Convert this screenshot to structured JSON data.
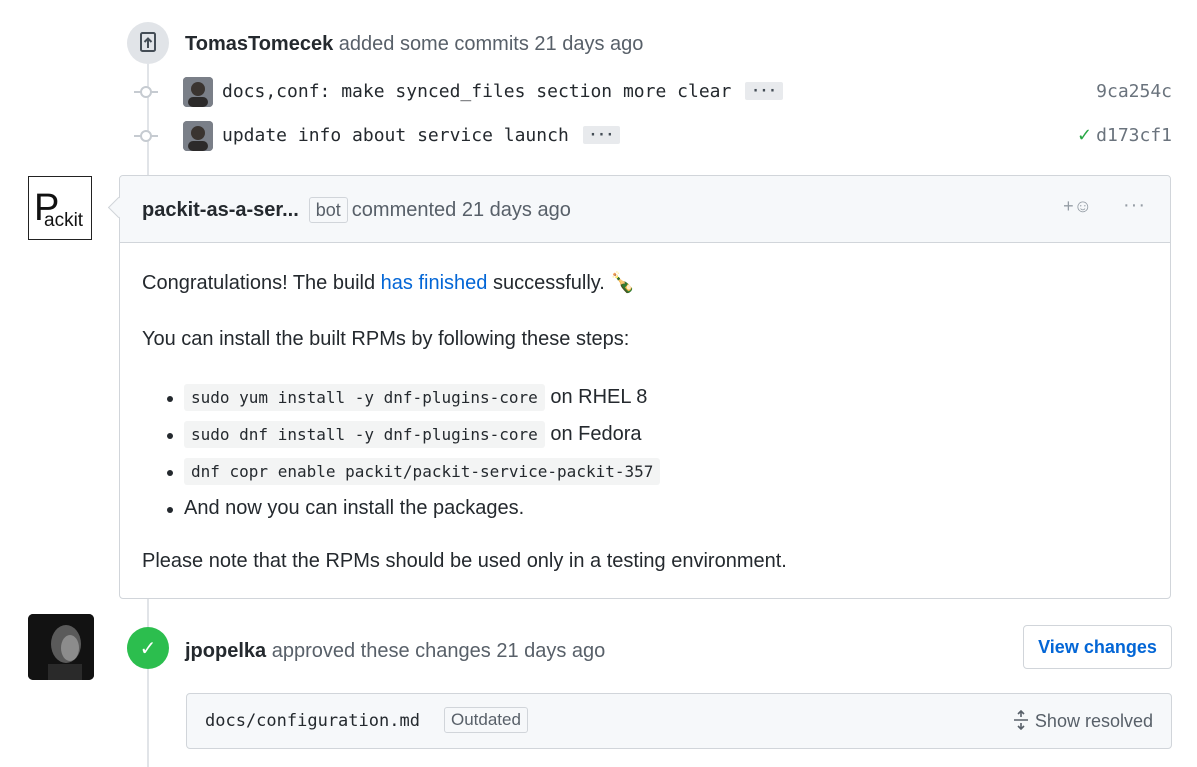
{
  "commits_event": {
    "author": "TomasTomecek",
    "action": "added some commits",
    "time": "21 days ago"
  },
  "commits": [
    {
      "message": "docs,conf: make synced_files section more clear",
      "sha": "9ca254c",
      "verified_check": false
    },
    {
      "message": "update info about service launch",
      "sha": "d173cf1",
      "verified_check": true
    }
  ],
  "comment": {
    "author": "packit-as-a-ser...",
    "badge": "bot",
    "action": "commented",
    "time": "21 days ago",
    "avatar_text": "ackit",
    "avatar_letter": "P",
    "reaction_label": "+☺",
    "more_label": "···",
    "congrats_before": "Congratulations! The build ",
    "congrats_link": "has finished",
    "congrats_after": " successfully. 🍾",
    "intro": "You can install the built RPMs by following these steps:",
    "steps": [
      {
        "code": "sudo yum install -y dnf-plugins-core",
        "suffix": " on RHEL 8"
      },
      {
        "code": "sudo dnf install -y dnf-plugins-core",
        "suffix": " on Fedora"
      },
      {
        "code": "dnf copr enable packit/packit-service-packit-357",
        "suffix": ""
      },
      {
        "code": "",
        "suffix": "And now you can install the packages."
      }
    ],
    "note": "Please note that the RPMs should be used only in a testing environment."
  },
  "review": {
    "author": "jpopelka",
    "action": "approved these changes",
    "time": "21 days ago",
    "view_changes_label": "View changes",
    "file_path": "docs/configuration.md",
    "outdated_label": "Outdated",
    "show_resolved_label": "Show resolved"
  },
  "colors": {
    "link": "#0366d6",
    "approved": "#2cbe4e",
    "check": "#28a745"
  }
}
